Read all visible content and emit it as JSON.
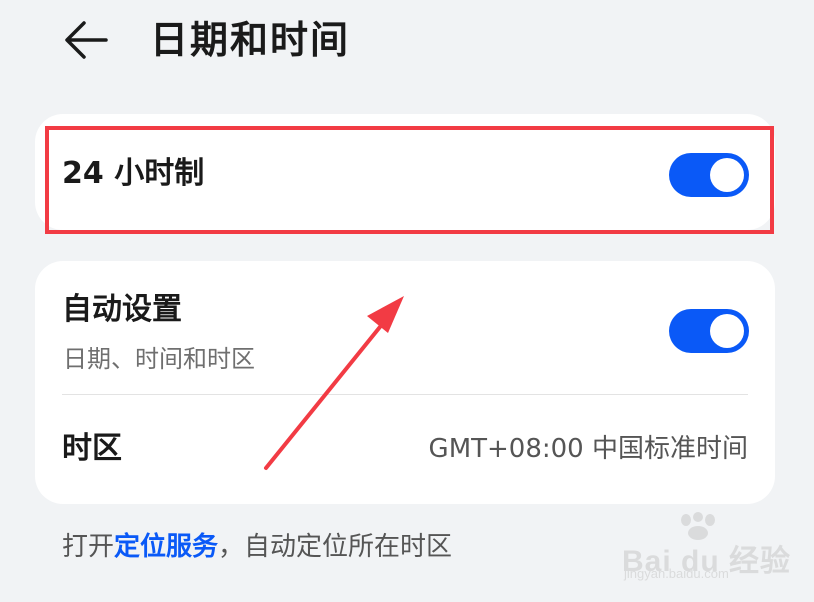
{
  "header": {
    "back_icon": "arrow-left-icon",
    "title": "日期和时间"
  },
  "settings": {
    "hour24": {
      "label": "24 小时制",
      "enabled": true
    },
    "auto_set": {
      "label": "自动设置",
      "subtitle": "日期、时间和时区",
      "enabled": true
    },
    "timezone": {
      "label": "时区",
      "value": "GMT+08:00 中国标准时间"
    }
  },
  "footer": {
    "prefix": "打开",
    "link": "定位服务",
    "suffix": "，自动定位所在时区"
  },
  "annotation": {
    "highlight_color": "#f23b44",
    "arrow_color": "#f23b44"
  },
  "watermark": {
    "brand": "Bai du 经验",
    "url": "jingyan.baidu.com"
  },
  "colors": {
    "accent": "#0a59f7",
    "background": "#f1f3f5",
    "card": "#ffffff"
  }
}
